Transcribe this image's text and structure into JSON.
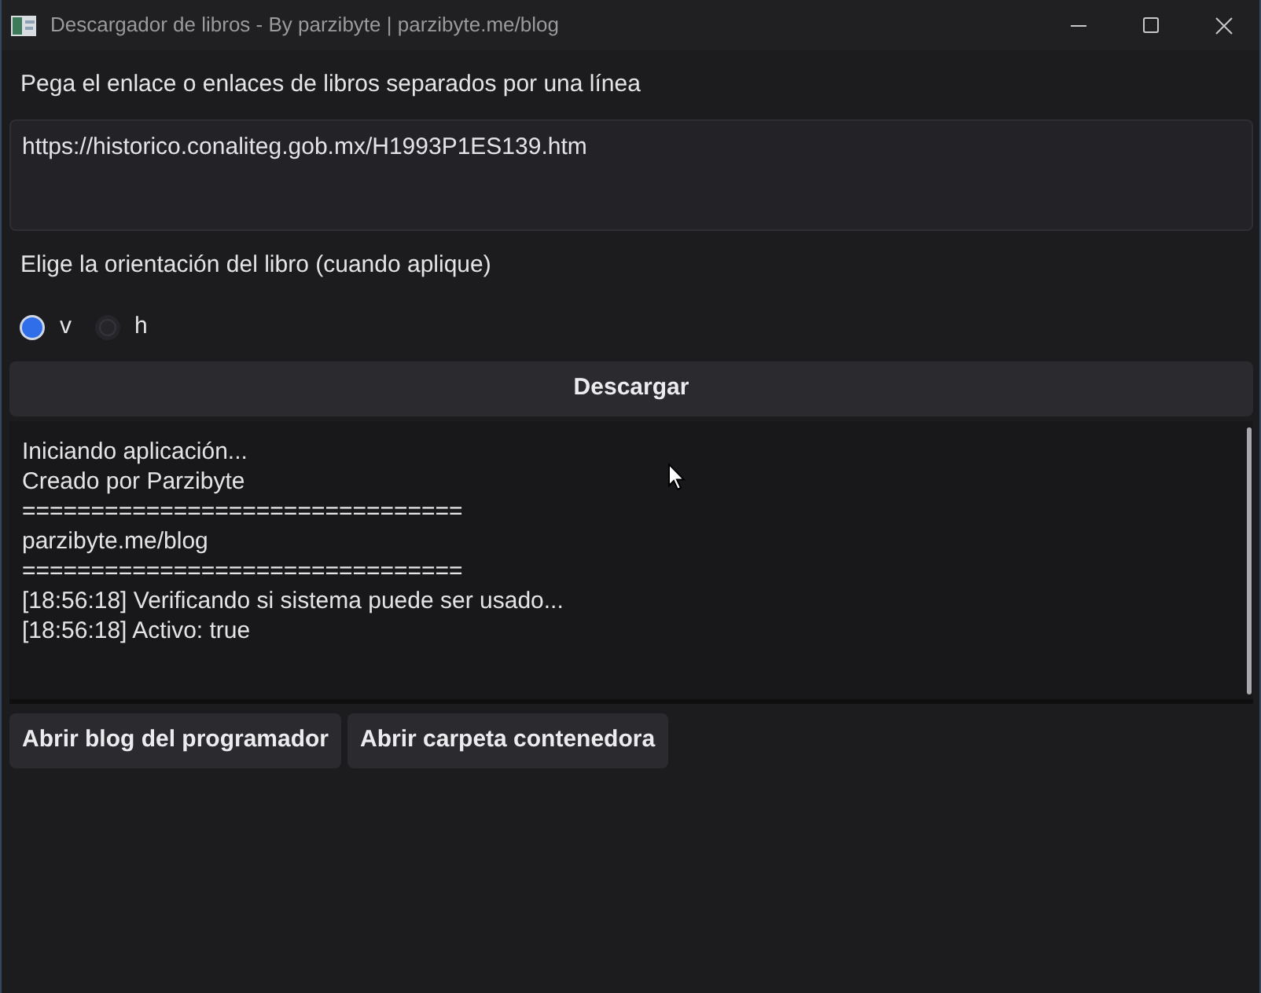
{
  "window": {
    "title": "Descargador de libros - By parzibyte | parzibyte.me/blog"
  },
  "links_label": "Pega el enlace o enlaces de libros separados por una línea",
  "links_field": {
    "value": "https://historico.conaliteg.gob.mx/H1993P1ES139.htm"
  },
  "orientation_label": "Elige la orientación del libro (cuando aplique)",
  "orientation_options": [
    {
      "label": "v",
      "selected": true
    },
    {
      "label": "h",
      "selected": false
    }
  ],
  "download_button": "Descargar",
  "log": {
    "lines": [
      "Iniciando aplicación...",
      "Creado por Parzibyte",
      "================================",
      "parzibyte.me/blog",
      "================================",
      "[18:56:18] Verificando si sistema puede ser usado...",
      "[18:56:18] Activo: true"
    ]
  },
  "buttons": [
    "Abrir blog del programador",
    "Abrir carpeta contenedora"
  ]
}
